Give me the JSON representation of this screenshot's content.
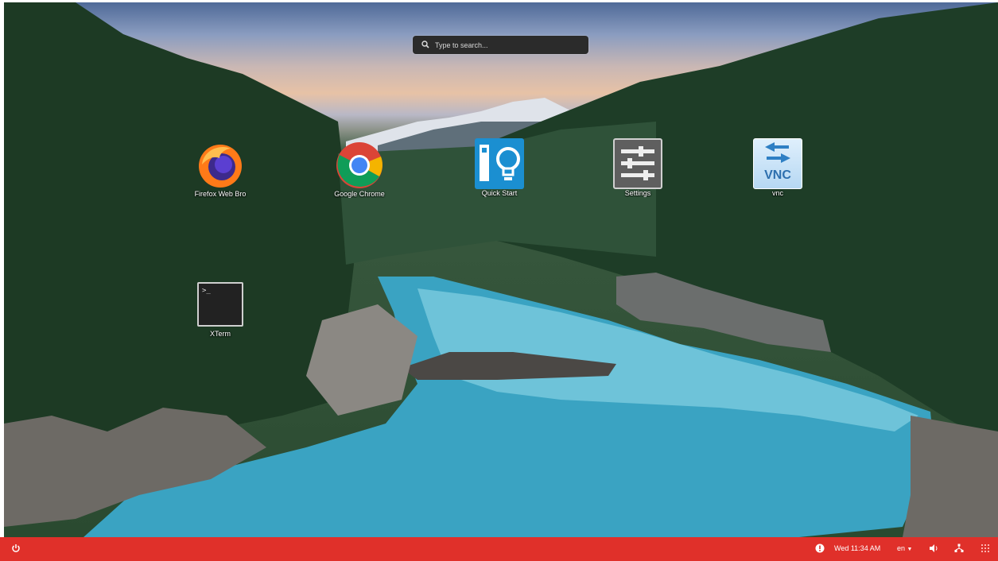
{
  "search": {
    "placeholder": "Type to search..."
  },
  "desktop_icons": [
    {
      "label": "Firefox Web Bro",
      "icon": "firefox-icon"
    },
    {
      "label": "Google Chrome",
      "icon": "chrome-icon"
    },
    {
      "label": "Quick Start",
      "icon": "lightbulb-icon"
    },
    {
      "label": "Settings",
      "icon": "sliders-icon"
    },
    {
      "label": "vnc",
      "icon": "vnc-icon",
      "icon_text": "VNC"
    },
    {
      "label": "XTerm",
      "icon": "terminal-icon",
      "icon_text": ">_"
    }
  ],
  "taskbar": {
    "color": "#e0302a",
    "clock": "Wed 11:34 AM",
    "language": "en",
    "icons": [
      "power-icon",
      "notification-icon",
      "volume-icon",
      "network-icon",
      "app-grid-icon"
    ]
  }
}
